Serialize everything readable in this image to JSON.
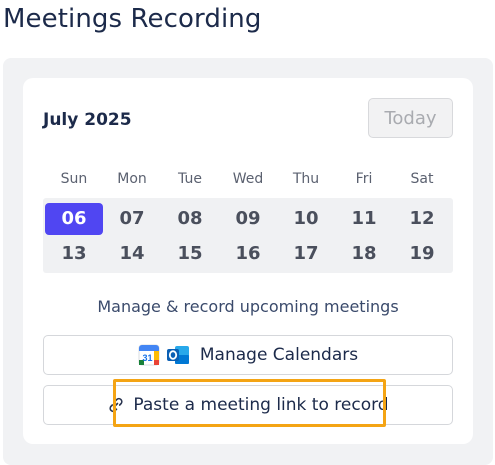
{
  "page": {
    "title": "Meetings Recording"
  },
  "calendar": {
    "month_label": "July 2025",
    "today_label": "Today",
    "weekdays": [
      "Sun",
      "Mon",
      "Tue",
      "Wed",
      "Thu",
      "Fri",
      "Sat"
    ],
    "week1": [
      "06",
      "07",
      "08",
      "09",
      "10",
      "11",
      "12"
    ],
    "week2": [
      "13",
      "14",
      "15",
      "16",
      "17",
      "18",
      "19"
    ],
    "selected_day": "06"
  },
  "actions": {
    "manage_text": "Manage & record upcoming meetings",
    "manage_calendars_label": "Manage Calendars",
    "paste_link_label": "Paste a meeting link to record"
  },
  "colors": {
    "accent": "#5046f2",
    "highlight": "#f4a414"
  },
  "icons": {
    "google_calendar": "google-calendar-icon",
    "outlook": "outlook-icon",
    "link": "link-icon"
  }
}
